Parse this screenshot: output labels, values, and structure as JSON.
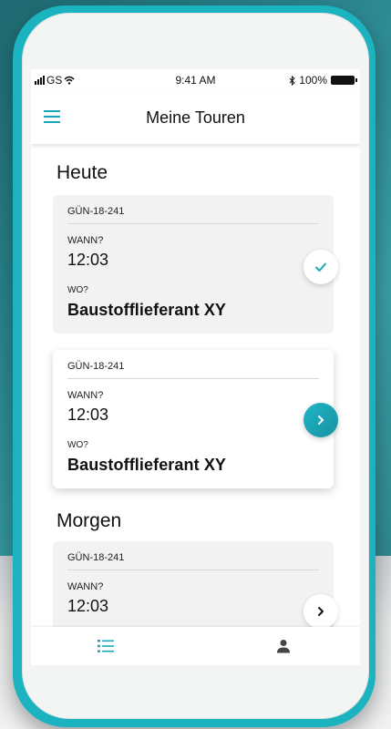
{
  "status_bar": {
    "carrier": "GS",
    "time": "9:41 AM",
    "battery": "100%"
  },
  "header": {
    "title": "Meine Touren",
    "menu_icon": "hamburger-menu-icon"
  },
  "sections": [
    {
      "title": "Heute",
      "cards": [
        {
          "code": "GÜN-18-241",
          "when_label": "WANN?",
          "time": "12:03",
          "where_label": "WO?",
          "place": "Baustofflieferant XY",
          "action_icon": "check-icon"
        },
        {
          "code": "GÜN-18-241",
          "when_label": "WANN?",
          "time": "12:03",
          "where_label": "WO?",
          "place": "Baustofflieferant XY",
          "action_icon": "chevron-right-icon"
        }
      ]
    },
    {
      "title": "Morgen",
      "cards": [
        {
          "code": "GÜN-18-241",
          "when_label": "WANN?",
          "time": "12:03",
          "action_icon": "chevron-right-icon"
        }
      ]
    }
  ],
  "bottom_nav": {
    "items": [
      {
        "icon": "list-icon",
        "active": true
      },
      {
        "icon": "profile-icon",
        "active": false
      }
    ]
  },
  "colors": {
    "accent": "#1aa8b7",
    "shell": "#1cb3c0"
  }
}
